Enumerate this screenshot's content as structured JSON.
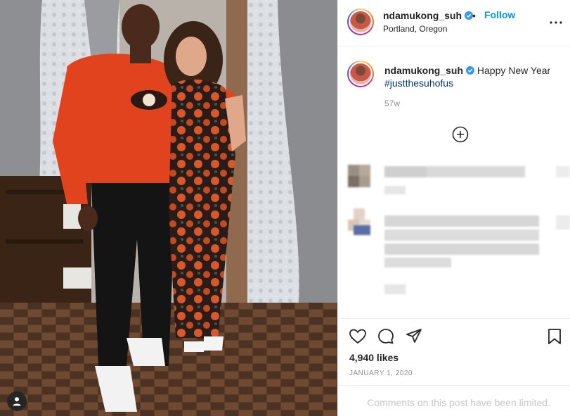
{
  "post": {
    "username": "ndamukong_suh",
    "verified": true,
    "follow_label": "Follow",
    "separator": "•",
    "location": "Portland, Oregon",
    "caption_text": "Happy New Year",
    "caption_hashtag": "#justthesuhofus",
    "age": "57w",
    "likes": "4,940 likes",
    "date": "January 1, 2020",
    "comments_limited": "Comments on this post have been limited."
  },
  "icons": {
    "more": "more-options-icon",
    "verified": "verified-badge-icon",
    "load_more": "plus-circle-icon",
    "like": "heart-icon",
    "comment": "comment-bubble-icon",
    "share": "paper-plane-icon",
    "save": "bookmark-icon",
    "user_tag": "user-tag-icon"
  },
  "colors": {
    "accent": "#0095f6",
    "hashtag": "#00376b",
    "muted": "#8e8e8e",
    "limited_text": "#c7c7c7",
    "border": "#efefef"
  }
}
